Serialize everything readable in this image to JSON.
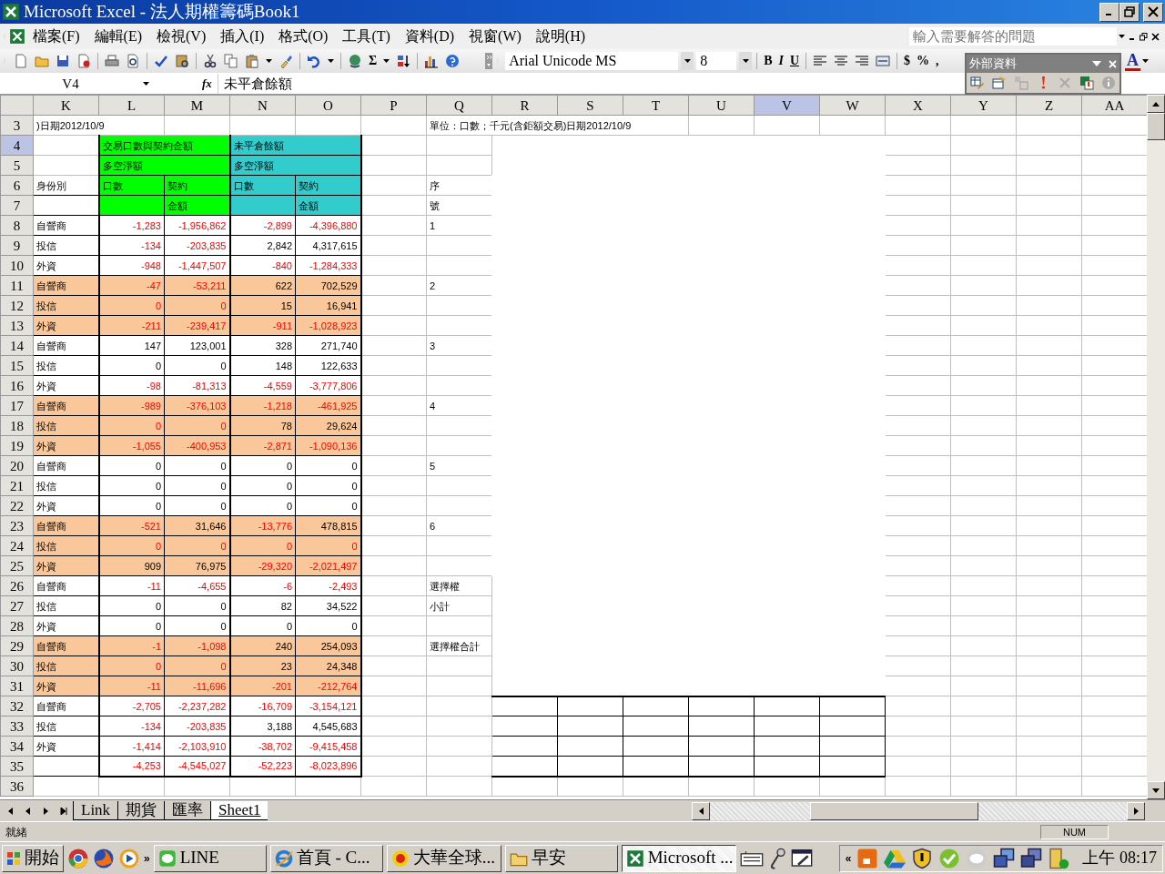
{
  "window": {
    "title": "Microsoft Excel - 法人期權籌碼Book1"
  },
  "menu": [
    {
      "label": "檔案(F)"
    },
    {
      "label": "編輯(E)"
    },
    {
      "label": "檢視(V)"
    },
    {
      "label": "插入(I)"
    },
    {
      "label": "格式(O)"
    },
    {
      "label": "工具(T)"
    },
    {
      "label": "資料(D)"
    },
    {
      "label": "視窗(W)"
    },
    {
      "label": "說明(H)"
    }
  ],
  "help_search": {
    "placeholder": "輸入需要解答的問題"
  },
  "toolbar": {
    "autosum": "Σ",
    "font_name": "Arial Unicode MS",
    "font_size": "8",
    "bold": "B",
    "italic": "I",
    "underline": "U",
    "currency": "$",
    "percent": "%",
    "comma": ",",
    "font_color": "A"
  },
  "external_data_toolbar": {
    "title": "外部資料"
  },
  "formula_bar": {
    "name_box": "V4",
    "function_label": "fx",
    "value": "未平倉餘額"
  },
  "columns": [
    {
      "label": "K",
      "selected": false
    },
    {
      "label": "L",
      "selected": false
    },
    {
      "label": "M",
      "selected": false
    },
    {
      "label": "N",
      "selected": false
    },
    {
      "label": "O",
      "selected": false
    },
    {
      "label": "P",
      "selected": false
    },
    {
      "label": "Q",
      "selected": false
    },
    {
      "label": "R",
      "selected": false
    },
    {
      "label": "S",
      "selected": false
    },
    {
      "label": "T",
      "selected": false
    },
    {
      "label": "U",
      "selected": false
    },
    {
      "label": "V",
      "selected": true
    },
    {
      "label": "W",
      "selected": false
    },
    {
      "label": "X",
      "selected": false
    },
    {
      "label": "Y",
      "selected": false
    },
    {
      "label": "Z",
      "selected": false
    },
    {
      "label": "AA",
      "selected": false
    }
  ],
  "title_row": {
    "number": "3",
    "selected": false,
    "left_text": ")日期2012/10/9",
    "right_text": "單位：口數；千元(含鉅額交易)日期2012/10/9"
  },
  "header_rows": [
    {
      "number": "4",
      "selected": true,
      "l": "交易口數與契約金額",
      "n": "未平倉餘額"
    },
    {
      "number": "5",
      "selected": false,
      "l": "多空淨額",
      "n": "多空淨額"
    },
    {
      "number": "6",
      "selected": false,
      "k": "身份別",
      "l": "口數",
      "m": "契約",
      "n": "口數",
      "o": "契約",
      "q": "序"
    },
    {
      "number": "7",
      "selected": false,
      "m": "金額",
      "o": "金額",
      "q": "號"
    }
  ],
  "rows": [
    {
      "number": "8",
      "selected": false,
      "shaded": false,
      "label": "自營商",
      "q": "1",
      "values": [
        {
          "text": "-1,283",
          "red": true
        },
        {
          "text": "-1,956,862",
          "red": true
        },
        {
          "text": "-2,899",
          "red": true
        },
        {
          "text": "-4,396,880",
          "red": true
        }
      ]
    },
    {
      "number": "9",
      "selected": false,
      "shaded": false,
      "label": "投信",
      "values": [
        {
          "text": "-134",
          "red": true
        },
        {
          "text": "-203,835",
          "red": true
        },
        {
          "text": "2,842",
          "red": false
        },
        {
          "text": "4,317,615",
          "red": false
        }
      ]
    },
    {
      "number": "10",
      "selected": false,
      "shaded": false,
      "label": "外資",
      "values": [
        {
          "text": "-948",
          "red": true
        },
        {
          "text": "-1,447,507",
          "red": true
        },
        {
          "text": "-840",
          "red": true
        },
        {
          "text": "-1,284,333",
          "red": true
        }
      ]
    },
    {
      "number": "11",
      "selected": false,
      "shaded": true,
      "label": "自營商",
      "q": "2",
      "values": [
        {
          "text": "-47",
          "red": true
        },
        {
          "text": "-53,211",
          "red": true
        },
        {
          "text": "622",
          "red": false
        },
        {
          "text": "702,529",
          "red": false
        }
      ]
    },
    {
      "number": "12",
      "selected": false,
      "shaded": true,
      "label": "投信",
      "values": [
        {
          "text": "0",
          "red": true
        },
        {
          "text": "0",
          "red": true
        },
        {
          "text": "15",
          "red": false
        },
        {
          "text": "16,941",
          "red": false
        }
      ]
    },
    {
      "number": "13",
      "selected": false,
      "shaded": true,
      "label": "外資",
      "values": [
        {
          "text": "-211",
          "red": true
        },
        {
          "text": "-239,417",
          "red": true
        },
        {
          "text": "-911",
          "red": true
        },
        {
          "text": "-1,028,923",
          "red": true
        }
      ]
    },
    {
      "number": "14",
      "selected": false,
      "shaded": false,
      "label": "自營商",
      "q": "3",
      "values": [
        {
          "text": "147",
          "red": false
        },
        {
          "text": "123,001",
          "red": false
        },
        {
          "text": "328",
          "red": false
        },
        {
          "text": "271,740",
          "red": false
        }
      ]
    },
    {
      "number": "15",
      "selected": false,
      "shaded": false,
      "label": "投信",
      "values": [
        {
          "text": "0",
          "red": false
        },
        {
          "text": "0",
          "red": false
        },
        {
          "text": "148",
          "red": false
        },
        {
          "text": "122,633",
          "red": false
        }
      ]
    },
    {
      "number": "16",
      "selected": false,
      "shaded": false,
      "label": "外資",
      "values": [
        {
          "text": "-98",
          "red": true
        },
        {
          "text": "-81,313",
          "red": true
        },
        {
          "text": "-4,559",
          "red": true
        },
        {
          "text": "-3,777,806",
          "red": true
        }
      ]
    },
    {
      "number": "17",
      "selected": false,
      "shaded": true,
      "label": "自營商",
      "q": "4",
      "values": [
        {
          "text": "-989",
          "red": true
        },
        {
          "text": "-376,103",
          "red": true
        },
        {
          "text": "-1,218",
          "red": true
        },
        {
          "text": "-461,925",
          "red": true
        }
      ]
    },
    {
      "number": "18",
      "selected": false,
      "shaded": true,
      "label": "投信",
      "values": [
        {
          "text": "0",
          "red": true
        },
        {
          "text": "0",
          "red": true
        },
        {
          "text": "78",
          "red": false
        },
        {
          "text": "29,624",
          "red": false
        }
      ]
    },
    {
      "number": "19",
      "selected": false,
      "shaded": true,
      "label": "外資",
      "values": [
        {
          "text": "-1,055",
          "red": true
        },
        {
          "text": "-400,953",
          "red": true
        },
        {
          "text": "-2,871",
          "red": true
        },
        {
          "text": "-1,090,136",
          "red": true
        }
      ]
    },
    {
      "number": "20",
      "selected": false,
      "shaded": false,
      "label": "自營商",
      "q": "5",
      "values": [
        {
          "text": "0",
          "red": false
        },
        {
          "text": "0",
          "red": false
        },
        {
          "text": "0",
          "red": false
        },
        {
          "text": "0",
          "red": false
        }
      ]
    },
    {
      "number": "21",
      "selected": false,
      "shaded": false,
      "label": "投信",
      "values": [
        {
          "text": "0",
          "red": false
        },
        {
          "text": "0",
          "red": false
        },
        {
          "text": "0",
          "red": false
        },
        {
          "text": "0",
          "red": false
        }
      ]
    },
    {
      "number": "22",
      "selected": false,
      "shaded": false,
      "label": "外資",
      "values": [
        {
          "text": "0",
          "red": false
        },
        {
          "text": "0",
          "red": false
        },
        {
          "text": "0",
          "red": false
        },
        {
          "text": "0",
          "red": false
        }
      ]
    },
    {
      "number": "23",
      "selected": false,
      "shaded": true,
      "label": "自營商",
      "q": "6",
      "values": [
        {
          "text": "-521",
          "red": true
        },
        {
          "text": "31,646",
          "red": false
        },
        {
          "text": "-13,776",
          "red": true
        },
        {
          "text": "478,815",
          "red": false
        }
      ]
    },
    {
      "number": "24",
      "selected": false,
      "shaded": true,
      "label": "投信",
      "values": [
        {
          "text": "0",
          "red": true
        },
        {
          "text": "0",
          "red": true
        },
        {
          "text": "0",
          "red": true
        },
        {
          "text": "0",
          "red": true
        }
      ]
    },
    {
      "number": "25",
      "selected": false,
      "shaded": true,
      "label": "外資",
      "values": [
        {
          "text": "909",
          "red": false
        },
        {
          "text": "76,975",
          "red": false
        },
        {
          "text": "-29,320",
          "red": true
        },
        {
          "text": "-2,021,497",
          "red": true
        }
      ]
    },
    {
      "number": "26",
      "selected": false,
      "shaded": false,
      "label": "自營商",
      "q": "選擇權",
      "values": [
        {
          "text": "-11",
          "red": true
        },
        {
          "text": "-4,655",
          "red": true
        },
        {
          "text": "-6",
          "red": true
        },
        {
          "text": "-2,493",
          "red": true
        }
      ]
    },
    {
      "number": "27",
      "selected": false,
      "shaded": false,
      "label": "投信",
      "q": "小計",
      "values": [
        {
          "text": "0",
          "red": false
        },
        {
          "text": "0",
          "red": false
        },
        {
          "text": "82",
          "red": false
        },
        {
          "text": "34,522",
          "red": false
        }
      ]
    },
    {
      "number": "28",
      "selected": false,
      "shaded": false,
      "label": "外資",
      "values": [
        {
          "text": "0",
          "red": false
        },
        {
          "text": "0",
          "red": false
        },
        {
          "text": "0",
          "red": false
        },
        {
          "text": "0",
          "red": false
        }
      ]
    },
    {
      "number": "29",
      "selected": false,
      "shaded": true,
      "label": "自營商",
      "q": "選擇權合計",
      "values": [
        {
          "text": "-1",
          "red": true
        },
        {
          "text": "-1,098",
          "red": true
        },
        {
          "text": "240",
          "red": false
        },
        {
          "text": "254,093",
          "red": false
        }
      ]
    },
    {
      "number": "30",
      "selected": false,
      "shaded": true,
      "label": "投信",
      "values": [
        {
          "text": "0",
          "red": true
        },
        {
          "text": "0",
          "red": true
        },
        {
          "text": "23",
          "red": false
        },
        {
          "text": "24,348",
          "red": false
        }
      ]
    },
    {
      "number": "31",
      "selected": false,
      "shaded": true,
      "label": "外資",
      "values": [
        {
          "text": "-11",
          "red": true
        },
        {
          "text": "-11,696",
          "red": true
        },
        {
          "text": "-201",
          "red": true
        },
        {
          "text": "-212,764",
          "red": true
        }
      ]
    },
    {
      "number": "32",
      "selected": false,
      "shaded": false,
      "label": "自營商",
      "values": [
        {
          "text": "-2,705",
          "red": true
        },
        {
          "text": "-2,237,282",
          "red": true
        },
        {
          "text": "-16,709",
          "red": true
        },
        {
          "text": "-3,154,121",
          "red": true
        }
      ]
    },
    {
      "number": "33",
      "selected": false,
      "shaded": false,
      "label": "投信",
      "values": [
        {
          "text": "-134",
          "red": true
        },
        {
          "text": "-203,835",
          "red": true
        },
        {
          "text": "3,188",
          "red": false
        },
        {
          "text": "4,545,683",
          "red": false
        }
      ]
    },
    {
      "number": "34",
      "selected": false,
      "shaded": false,
      "label": "外資",
      "values": [
        {
          "text": "-1,414",
          "red": true
        },
        {
          "text": "-2,103,910",
          "red": true
        },
        {
          "text": "-38,702",
          "red": true
        },
        {
          "text": "-9,415,458",
          "red": true
        }
      ]
    },
    {
      "number": "35",
      "selected": false,
      "shaded": false,
      "values": [
        {
          "text": "-4,253",
          "red": true
        },
        {
          "text": "-4,545,027",
          "red": true
        },
        {
          "text": "-52,223",
          "red": true
        },
        {
          "text": "-8,023,896",
          "red": true
        }
      ]
    },
    {
      "number": "36",
      "selected": false
    }
  ],
  "sheet_tabs": [
    {
      "label": "Link",
      "selected": false
    },
    {
      "label": "期貨",
      "selected": false
    },
    {
      "label": "匯率",
      "selected": false
    },
    {
      "label": "Sheet1",
      "selected": true
    }
  ],
  "status_bar": {
    "message": "就緒",
    "indicator": "NUM"
  },
  "taskbar": {
    "start": "開始",
    "more": "»",
    "tasks": [
      {
        "label": "LINE",
        "selected": false
      },
      {
        "label": "首頁 - C...",
        "selected": false
      },
      {
        "label": "大華全球...",
        "selected": false
      },
      {
        "label": "早安",
        "selected": false
      },
      {
        "label": "Microsoft ...",
        "selected": true
      }
    ],
    "tray_toggle": "«",
    "clock": "上午 08:17"
  }
}
